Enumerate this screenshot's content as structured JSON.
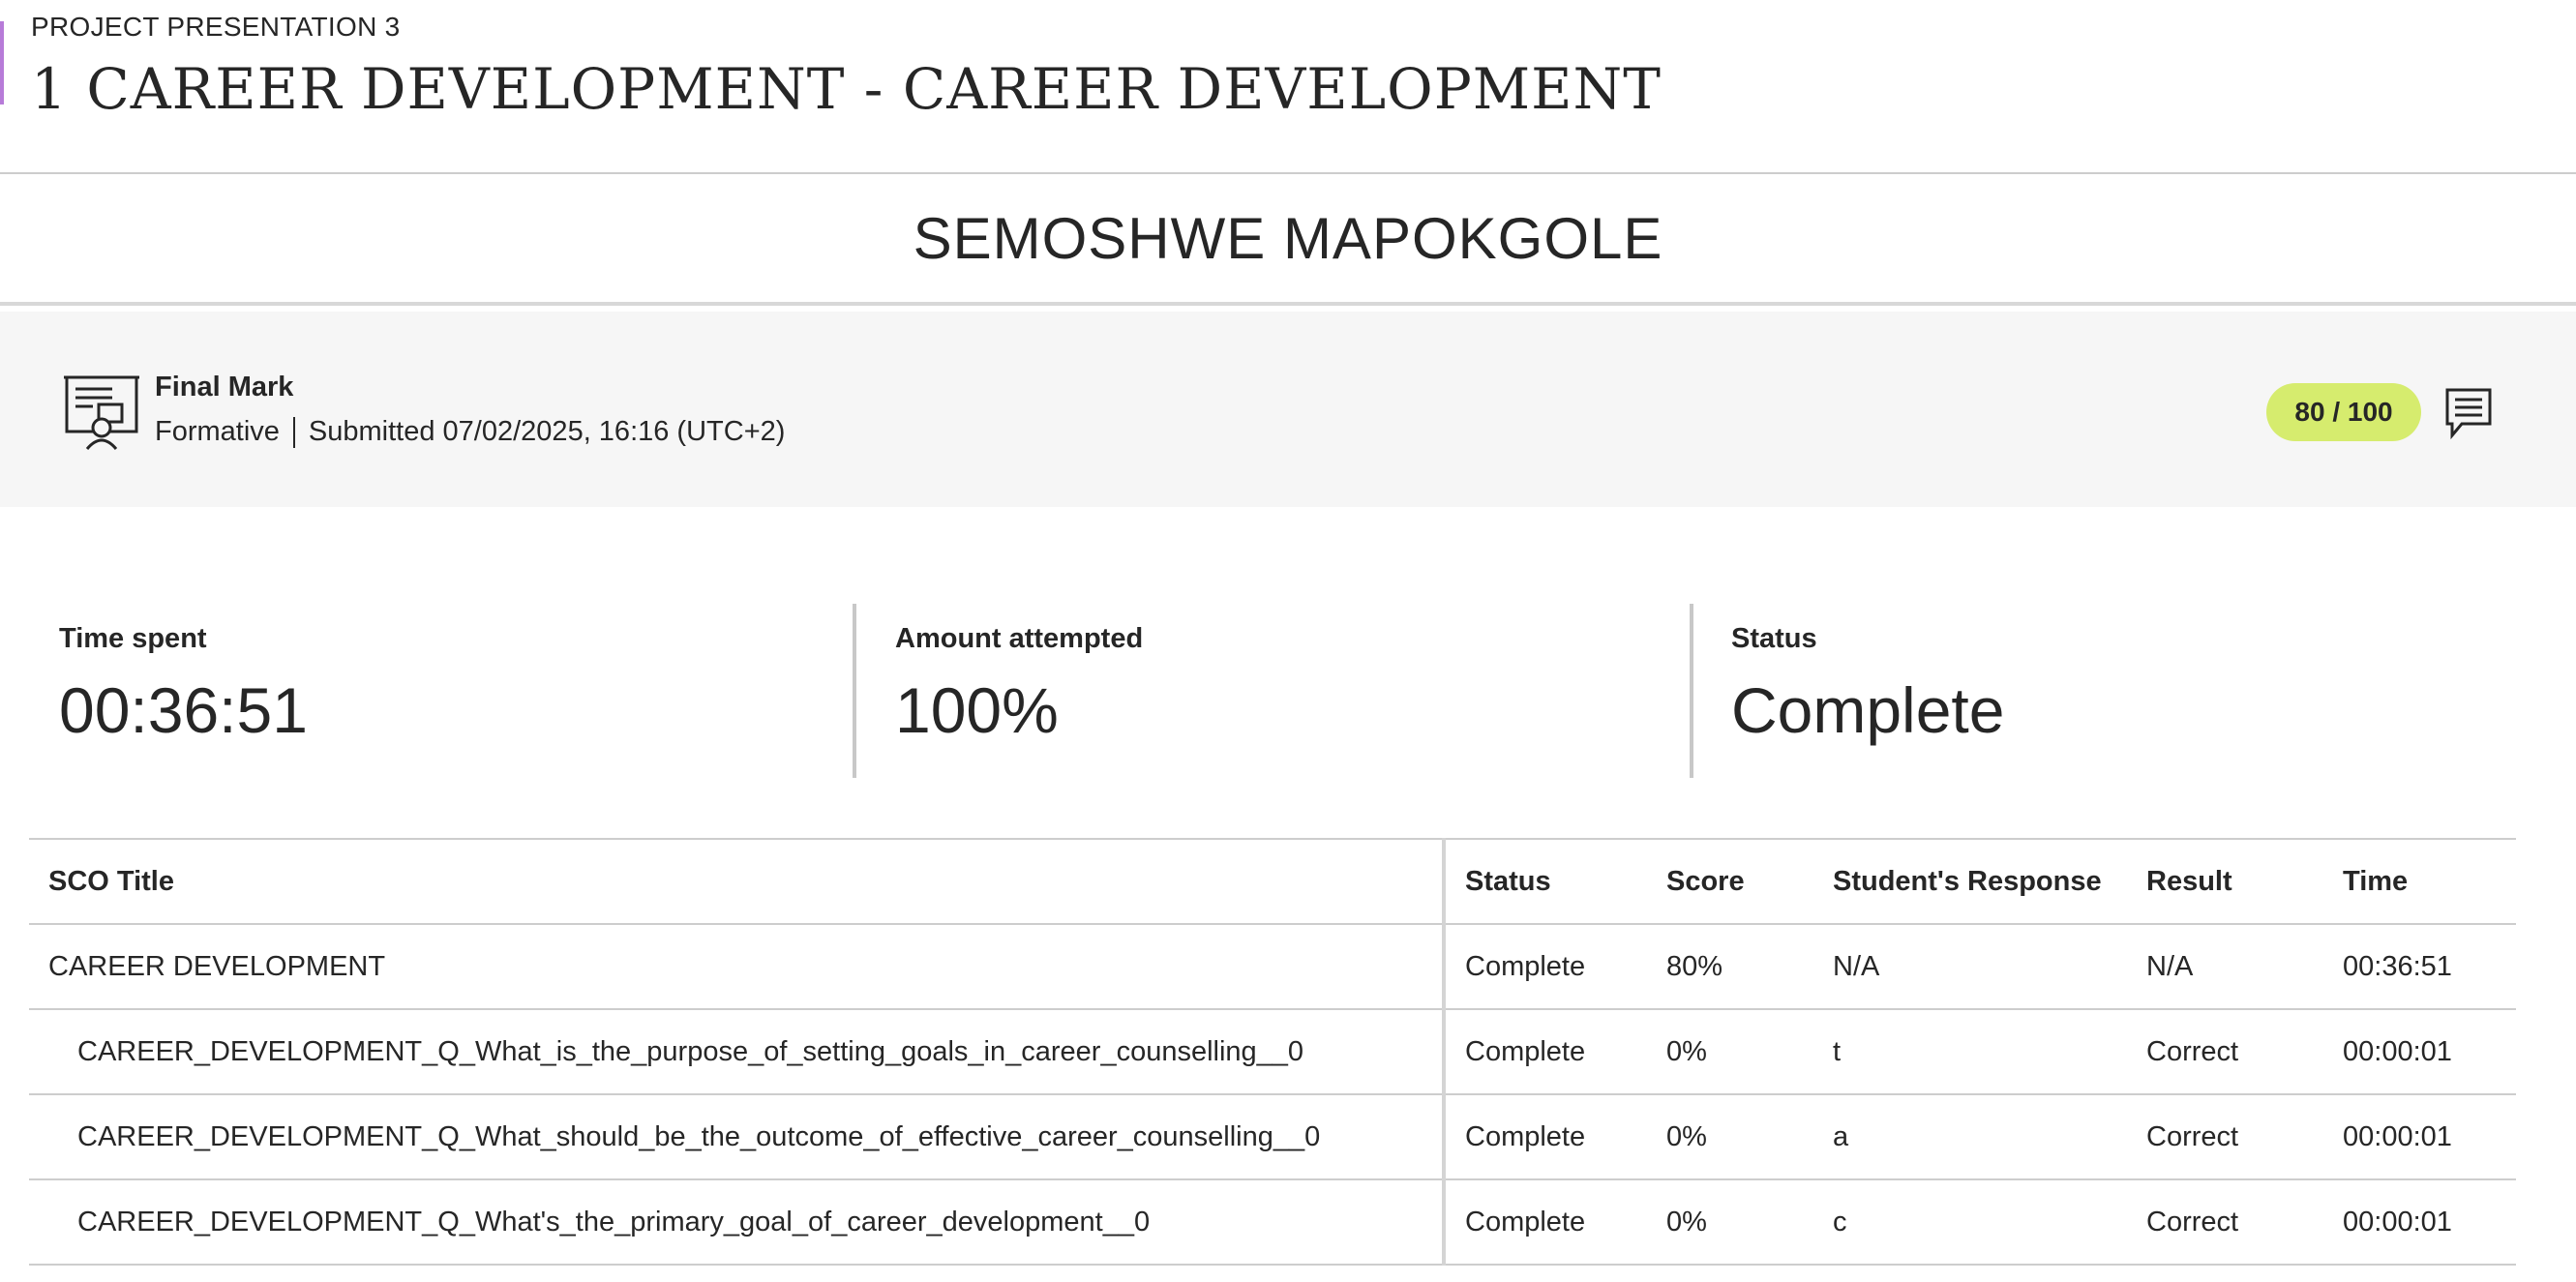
{
  "header": {
    "breadcrumb": "PROJECT PRESENTATION 3",
    "title": "1 CAREER DEVELOPMENT - CAREER DEVELOPMENT"
  },
  "student": {
    "name": "SEMOSHWE MAPOKGOLE"
  },
  "final_mark": {
    "icon": "presentation-icon",
    "title": "Final Mark",
    "type": "Formative",
    "submitted": "Submitted 07/02/2025, 16:16 (UTC+2)",
    "grade": "80 / 100",
    "grade_color": "#d6ec6e",
    "comment_icon": "comment-icon"
  },
  "stats": {
    "time_spent": {
      "label": "Time spent",
      "value": "00:36:51"
    },
    "amount_attempted": {
      "label": "Amount attempted",
      "value": "100%"
    },
    "status": {
      "label": "Status",
      "value": "Complete"
    }
  },
  "table": {
    "headers": [
      "SCO Title",
      "Status",
      "Score",
      "Student's Response",
      "Result",
      "Time"
    ],
    "rows": [
      {
        "title": "CAREER DEVELOPMENT",
        "status": "Complete",
        "score": "80%",
        "response": "N/A",
        "result": "N/A",
        "time": "00:36:51"
      },
      {
        "title": "CAREER_DEVELOPMENT_Q_What_is_the_purpose_of_setting_goals_in_career_counselling__0",
        "status": "Complete",
        "score": "0%",
        "response": "t",
        "result": "Correct",
        "time": "00:00:01"
      },
      {
        "title": "CAREER_DEVELOPMENT_Q_What_should_be_the_outcome_of_effective_career_counselling__0",
        "status": "Complete",
        "score": "0%",
        "response": "a",
        "result": "Correct",
        "time": "00:00:01"
      },
      {
        "title": "CAREER_DEVELOPMENT_Q_What's_the_primary_goal_of_career_development__0",
        "status": "Complete",
        "score": "0%",
        "response": "c",
        "result": "Correct",
        "time": "00:00:01"
      }
    ]
  }
}
